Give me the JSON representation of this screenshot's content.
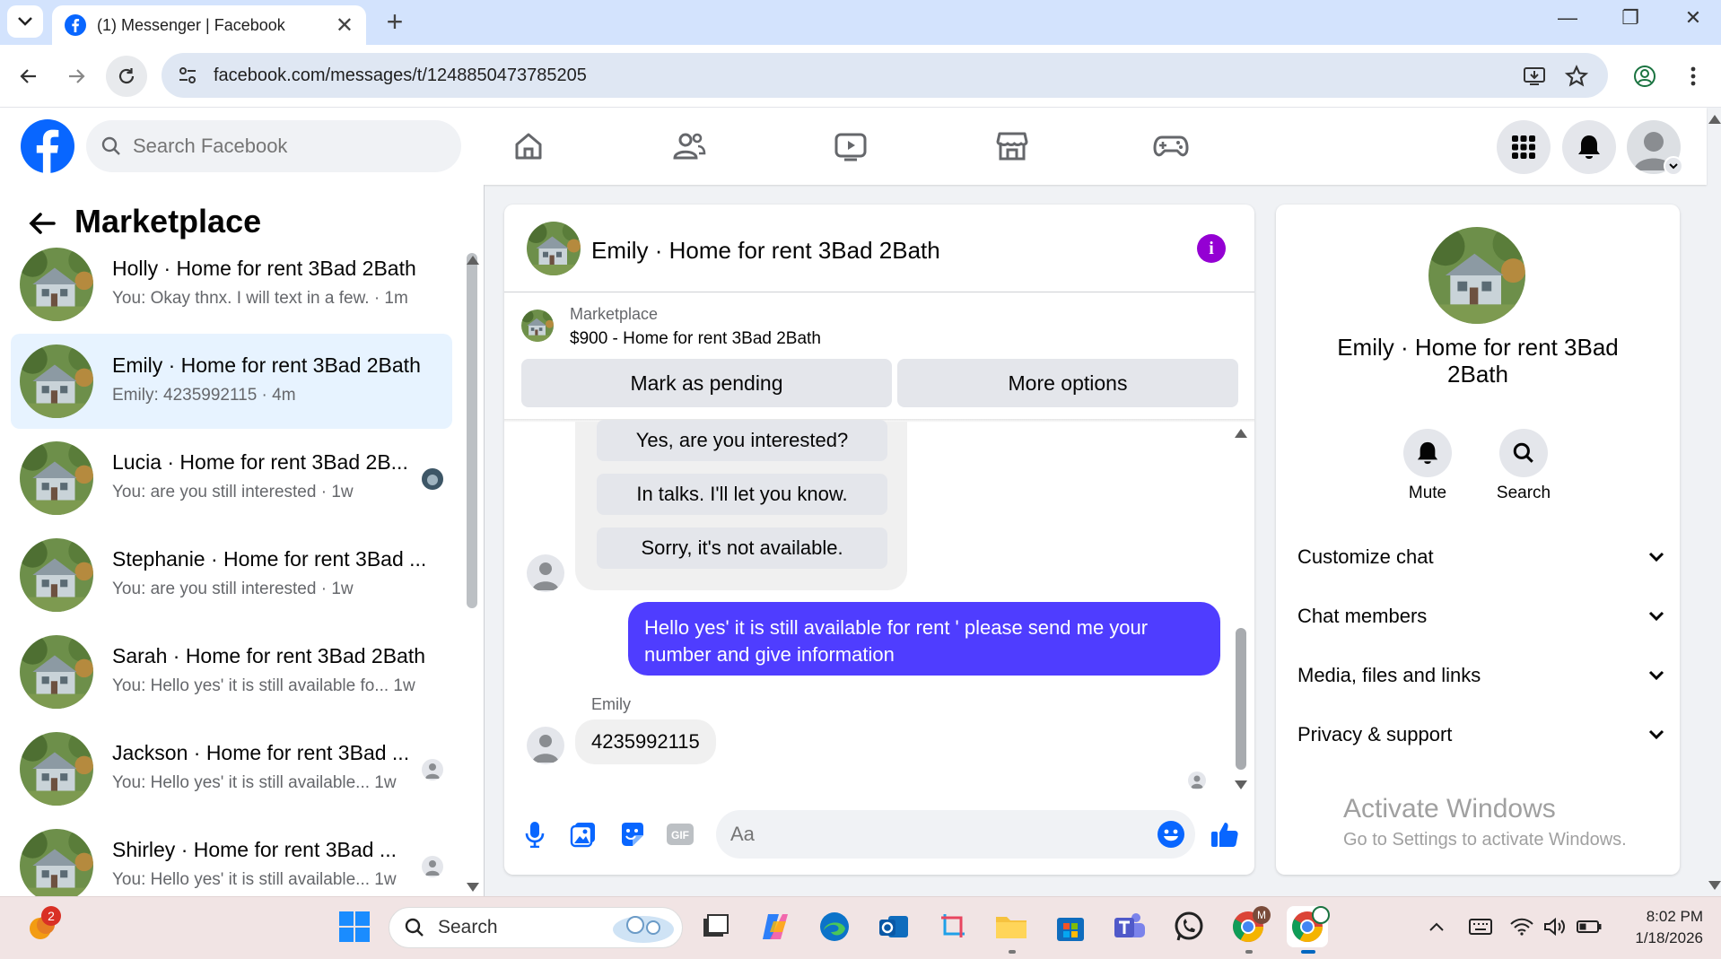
{
  "browser": {
    "tab_title": "(1) Messenger | Facebook",
    "url": "facebook.com/messages/t/1248850473785205"
  },
  "fb": {
    "search_placeholder": "Search Facebook"
  },
  "left": {
    "title": "Marketplace",
    "conversations": [
      {
        "name": "Holly · Home for rent 3Bad 2Bath",
        "preview": "You: Okay thnx. I will text in a few. · 1m"
      },
      {
        "name": "Emily · Home for rent 3Bad 2Bath",
        "preview": "Emily: 4235992115 · 4m"
      },
      {
        "name": "Lucia · Home for rent 3Bad 2B...",
        "preview": "You: are you still interested · 1w"
      },
      {
        "name": "Stephanie · Home for rent 3Bad ...",
        "preview": "You: are you still interested · 1w"
      },
      {
        "name": "Sarah · Home for rent 3Bad 2Bath",
        "preview": "You: Hello yes' it is still available fo...   1w"
      },
      {
        "name": "Jackson · Home for rent 3Bad ...",
        "preview": "You: Hello yes' it is still available...   1w"
      },
      {
        "name": "Shirley · Home for rent 3Bad ...",
        "preview": "You: Hello yes' it is still available...   1w"
      }
    ]
  },
  "chat": {
    "title": "Emily · Home for rent 3Bad 2Bath",
    "info_glyph": "i",
    "listing_category": "Marketplace",
    "listing_title": "$900 - Home for rent 3Bad 2Bath",
    "mark_pending": "Mark as pending",
    "more_options": "More options",
    "quick_replies": [
      "Yes, are you interested?",
      "In talks. I'll let you know.",
      "Sorry, it's not available."
    ],
    "outgoing": "Hello yes' it is still available for rent ' please send me your number and give information",
    "sender_label": "Emily",
    "incoming": "4235992115",
    "composer_placeholder": "Aa"
  },
  "right": {
    "name": "Emily · Home for rent 3Bad 2Bath",
    "mute_label": "Mute",
    "search_label": "Search",
    "sections": [
      "Customize chat",
      "Chat members",
      "Media, files and links",
      "Privacy & support"
    ],
    "watermark_title": "Activate Windows",
    "watermark_sub": "Go to Settings to activate Windows."
  },
  "taskbar": {
    "search_label": "Search",
    "notification_badge": "2",
    "time": "8:02 PM",
    "date": "1/18/2026"
  },
  "colors": {
    "fb_blue": "#0866ff",
    "outgoing_bubble": "#4f3dff",
    "info_purple": "#9400d3",
    "active_conv": "#e7f3ff"
  }
}
